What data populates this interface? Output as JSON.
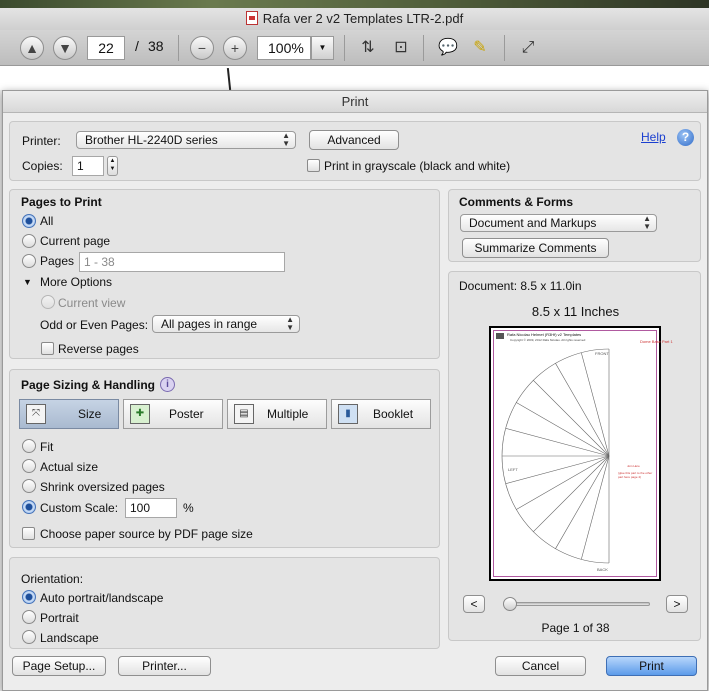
{
  "window": {
    "title": "Rafa ver 2 v2 Templates LTR-2.pdf"
  },
  "toolbar": {
    "page_current": "22",
    "page_sep": "/",
    "page_total": "38",
    "zoom": "100%"
  },
  "dialog": {
    "title": "Print",
    "printer_label": "Printer:",
    "printer_value": "Brother HL-2240D series",
    "advanced_label": "Advanced",
    "help_label": "Help",
    "copies_label": "Copies:",
    "copies_value": "1",
    "grayscale_label": "Print in grayscale (black and white)",
    "pages_to_print": {
      "heading": "Pages to Print",
      "all": "All",
      "current_page": "Current page",
      "pages": "Pages",
      "pages_placeholder": "1 - 38",
      "more_options": "More Options",
      "current_view": "Current view",
      "odd_even_label": "Odd or Even Pages:",
      "odd_even_value": "All pages in range",
      "reverse": "Reverse pages"
    },
    "sizing": {
      "heading": "Page Sizing & Handling",
      "tabs": [
        "Size",
        "Poster",
        "Multiple",
        "Booklet"
      ],
      "fit": "Fit",
      "actual_size": "Actual size",
      "shrink": "Shrink oversized pages",
      "custom_scale": "Custom Scale:",
      "custom_scale_value": "100",
      "percent": "%",
      "paper_source": "Choose paper source by PDF page size"
    },
    "orientation": {
      "heading": "Orientation:",
      "auto": "Auto portrait/landscape",
      "portrait": "Portrait",
      "landscape": "Landscape"
    },
    "comments": {
      "heading": "Comments & Forms",
      "value": "Document and Markups",
      "summarize": "Summarize Comments"
    },
    "preview": {
      "document_size": "Document: 8.5 x 11.0in",
      "page_size": "8.5 x 11 Inches",
      "page_label": "Page 1 of 38",
      "prev": "<",
      "next": ">",
      "slider_fraction": 0.0,
      "thumb_title": "Rafa Nicolau Helmet (R3Hf) v2 Templates",
      "thumb_copyright": "Copyright © 2009, 2012 Rafa Nicolau. All rights reserved",
      "thumb_part": "Dome Base Part 1",
      "thumb_front": "FRONT",
      "thumb_back": "BACK",
      "thumb_left": "LEFT",
      "thumb_note": "(glue this part to the other part here page 4)",
      "thumb_center": "Join Here"
    },
    "footer": {
      "page_setup": "Page Setup...",
      "printer": "Printer...",
      "cancel": "Cancel",
      "print": "Print"
    }
  },
  "colors": {
    "accent": "#3c78d8",
    "link": "#1a3fd0",
    "selected_segment": "#b0c0d6"
  }
}
